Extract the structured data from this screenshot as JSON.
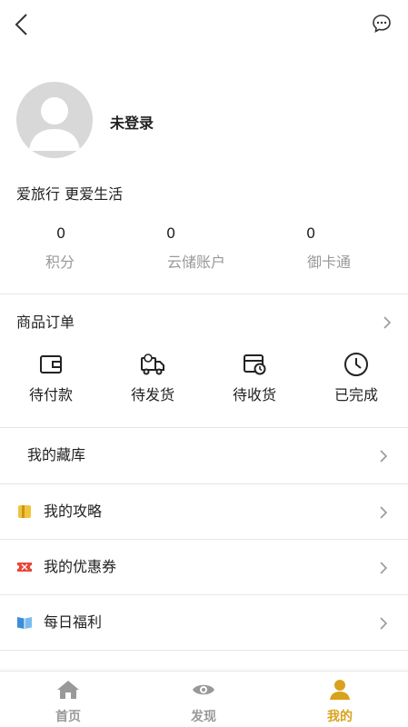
{
  "header": {
    "back_icon": "chevron-left-icon",
    "message_icon": "chat-bubble-icon"
  },
  "profile": {
    "username": "未登录",
    "slogan": "爱旅行 更爱生活",
    "avatar_icon": "default-avatar-icon"
  },
  "stats": [
    {
      "value": "0",
      "label": "积分"
    },
    {
      "value": "0",
      "label": "云储账户"
    },
    {
      "value": "0",
      "label": "御卡通"
    }
  ],
  "orders": {
    "title": "商品订单",
    "items": [
      {
        "label": "待付款",
        "icon": "wallet-icon"
      },
      {
        "label": "待发货",
        "icon": "delivery-truck-icon"
      },
      {
        "label": "待收货",
        "icon": "package-clock-icon"
      },
      {
        "label": "已完成",
        "icon": "clock-icon"
      }
    ]
  },
  "menu": [
    {
      "label": "我的藏库",
      "icon": ""
    },
    {
      "label": "我的攻略",
      "icon": "guide-book-icon"
    },
    {
      "label": "我的优惠券",
      "icon": "coupon-icon"
    },
    {
      "label": "每日福利",
      "icon": "open-book-icon"
    }
  ],
  "tabbar": {
    "tabs": [
      {
        "label": "首页",
        "icon": "home-icon",
        "active": false
      },
      {
        "label": "发现",
        "icon": "eye-icon",
        "active": false
      },
      {
        "label": "我的",
        "icon": "user-icon",
        "active": true
      }
    ]
  },
  "colors": {
    "accent": "#d9a21b",
    "muted": "#999999",
    "divider": "#e6e6e6"
  }
}
